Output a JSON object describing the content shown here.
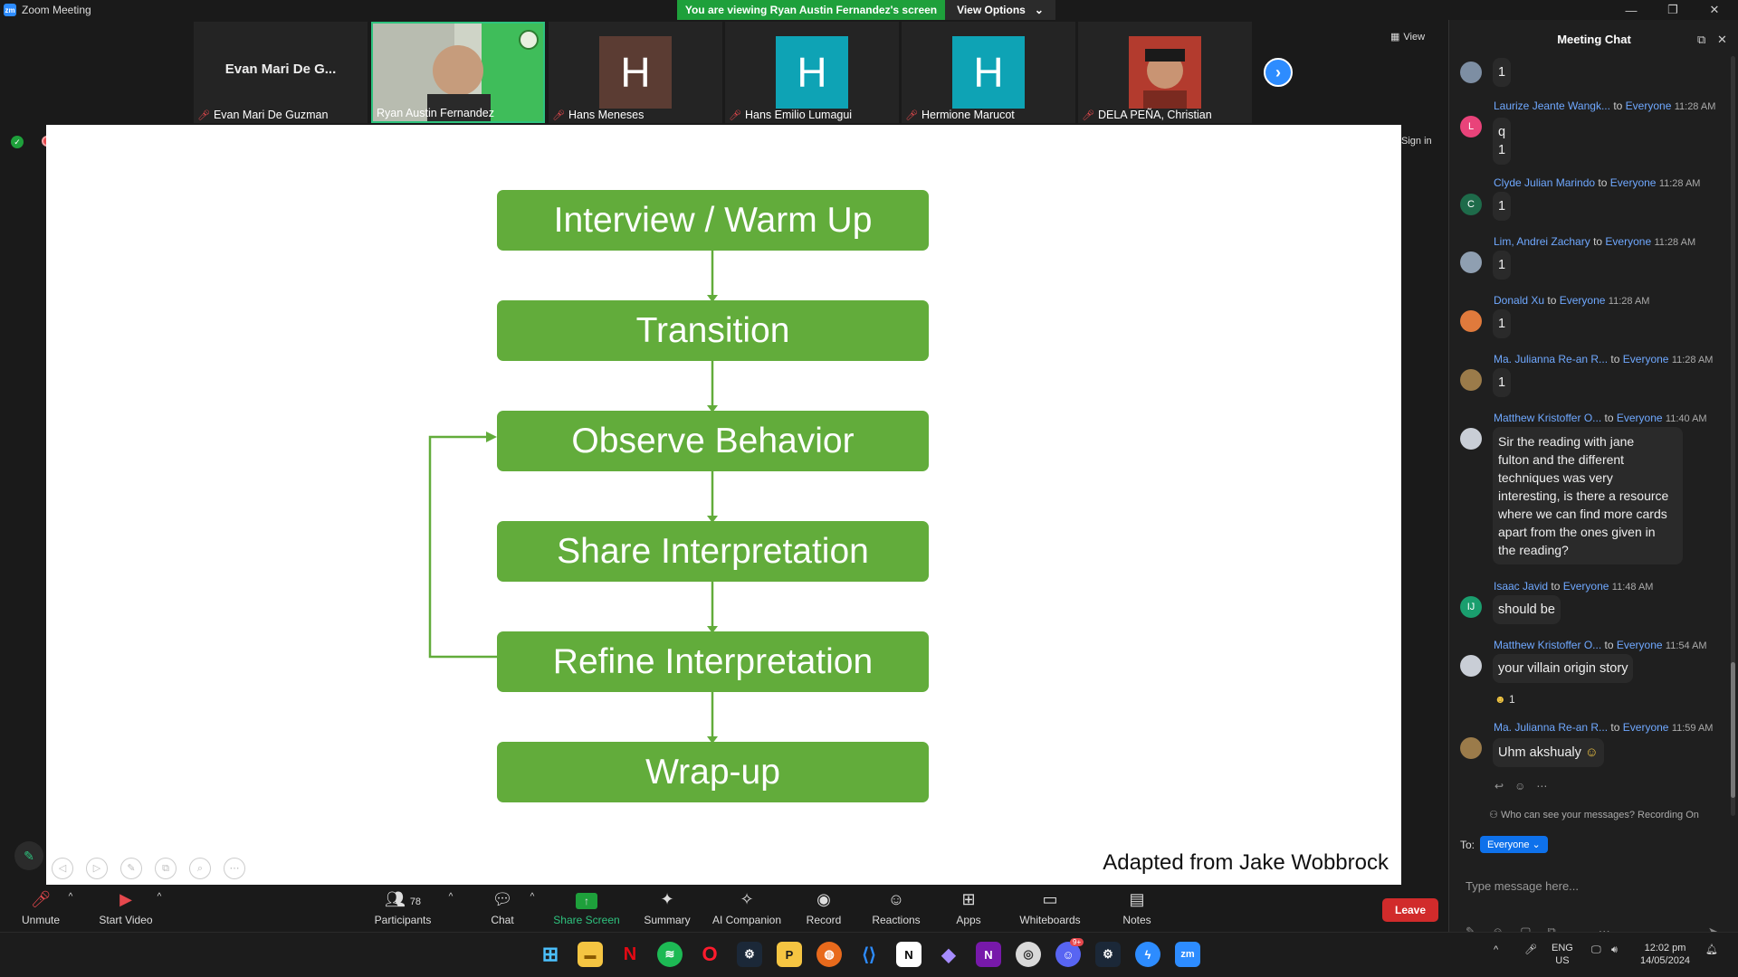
{
  "window": {
    "title": "Zoom Meeting",
    "viewing_banner": "You are viewing Ryan Austin Fernandez's screen",
    "view_options": "View Options"
  },
  "participants_strip": {
    "tiles": [
      {
        "big_name": "Evan Mari De G...",
        "label": "Evan Mari De Guzman"
      },
      {
        "label": "Ryan Austin Fernandez"
      },
      {
        "initial": "H",
        "label": "Hans Meneses"
      },
      {
        "initial": "H",
        "label": "Hans Emilio Lumagui"
      },
      {
        "initial": "H",
        "label": "Hermione Marucot"
      },
      {
        "label": "DELA PEÑA, Christian"
      }
    ],
    "view_label": "View"
  },
  "slide": {
    "steps": [
      "Interview / Warm Up",
      "Transition",
      "Observe Behavior",
      "Share Interpretation",
      "Refine Interpretation",
      "Wrap-up"
    ],
    "credit": "Adapted from Jake Wobbrock",
    "sign_in": "Sign in"
  },
  "toolbar": {
    "unmute": "Unmute",
    "start_video": "Start Video",
    "participants": "Participants",
    "participant_count": "78",
    "chat": "Chat",
    "share_screen": "Share Screen",
    "summary": "Summary",
    "ai_companion": "AI Companion",
    "record": "Record",
    "reactions": "Reactions",
    "apps": "Apps",
    "whiteboards": "Whiteboards",
    "notes": "Notes",
    "leave": "Leave"
  },
  "chat": {
    "title": "Meeting Chat",
    "messages": [
      {
        "text": "1"
      },
      {
        "sender": "Laurize Jeante Wangk...",
        "to": "to",
        "recipient": "Everyone",
        "time": "11:28 AM",
        "initial": "L",
        "line1": "q",
        "line2": "1"
      },
      {
        "sender": "Clyde Julian Marindo",
        "to": "to",
        "recipient": "Everyone",
        "time": "11:28 AM",
        "initial": "C",
        "text": "1"
      },
      {
        "sender": "Lim, Andrei Zachary",
        "to": "to",
        "recipient": "Everyone",
        "time": "11:28 AM",
        "text": "1"
      },
      {
        "sender": "Donald Xu",
        "to": "to",
        "recipient": "Everyone",
        "time": "11:28 AM",
        "text": "1"
      },
      {
        "sender": "Ma. Julianna Re-an R...",
        "to": "to",
        "recipient": "Everyone",
        "time": "11:28 AM",
        "text": "1"
      },
      {
        "sender": "Matthew Kristoffer O...",
        "to": "to",
        "recipient": "Everyone",
        "time": "11:40 AM",
        "lines": [
          "Sir the reading with jane",
          "fulton and the different",
          "techniques was very",
          "interesting, is there a resource",
          "where we can find more cards",
          "apart from the ones given in",
          "the reading?"
        ]
      },
      {
        "sender": "Isaac Javid",
        "to": "to",
        "recipient": "Everyone",
        "time": "11:48 AM",
        "initial": "IJ",
        "text": "should be"
      },
      {
        "sender": "Matthew Kristoffer O...",
        "to": "to",
        "recipient": "Everyone",
        "time": "11:54 AM",
        "text": "your villain origin story",
        "reaction_count": "1"
      },
      {
        "sender": "Ma. Julianna Re-an R...",
        "to": "to",
        "recipient": "Everyone",
        "time": "11:59 AM",
        "text": "Uhm akshualy"
      }
    ],
    "who_can_see": "Who can see your messages? Recording On",
    "to_label": "To:",
    "recipient_button": "Everyone",
    "placeholder": "Type message here..."
  },
  "taskbar": {
    "lang": "ENG",
    "region": "US",
    "time": "12:02 pm",
    "date": "14/05/2024",
    "discord_badge": "9+"
  },
  "colors": {
    "flow_green": "#62ac3b",
    "zoom_blue": "#2d8cff",
    "banner_green": "#1ea03b",
    "leave_red": "#d12b2b"
  }
}
